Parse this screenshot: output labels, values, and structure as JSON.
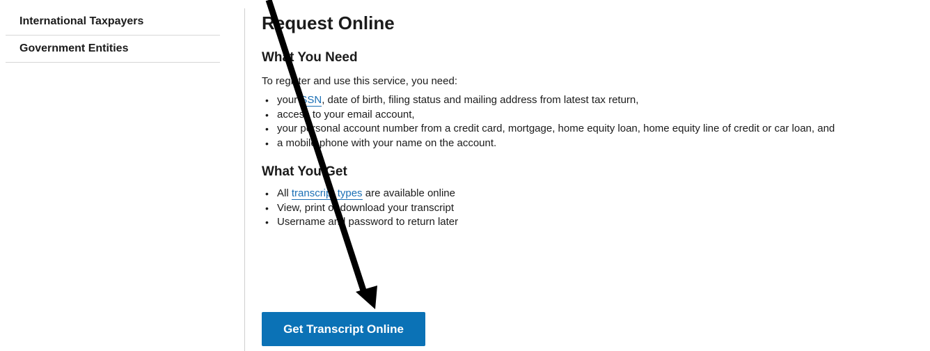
{
  "sidebar": {
    "items": [
      {
        "label": "International Taxpayers"
      },
      {
        "label": "Government Entities"
      }
    ]
  },
  "main": {
    "title": "Request Online",
    "need": {
      "heading": "What You Need",
      "intro": "To register and use this service, you need:",
      "bullet1": {
        "before": "your ",
        "link": "SSN",
        "after": ", date of birth, filing status and mailing address from latest tax return,"
      },
      "bullet2": "access to your email account,",
      "bullet3": "your personal account number from a credit card, mortgage, home equity loan, home equity line of credit or car loan, and",
      "bullet4": "a mobile phone with your name on the account."
    },
    "get": {
      "heading": "What You Get",
      "bullet1": {
        "before": "All ",
        "link": "transcript types",
        "after": " are available online"
      },
      "bullet2": "View, print or download your transcript",
      "bullet3": "Username and password to return later"
    },
    "button_label": "Get Transcript Online"
  },
  "colors": {
    "link": "#1a6fb5",
    "button": "#0b72b6",
    "annotation_arrow": "#000000"
  },
  "icons": [
    "annotation-arrow-icon"
  ]
}
